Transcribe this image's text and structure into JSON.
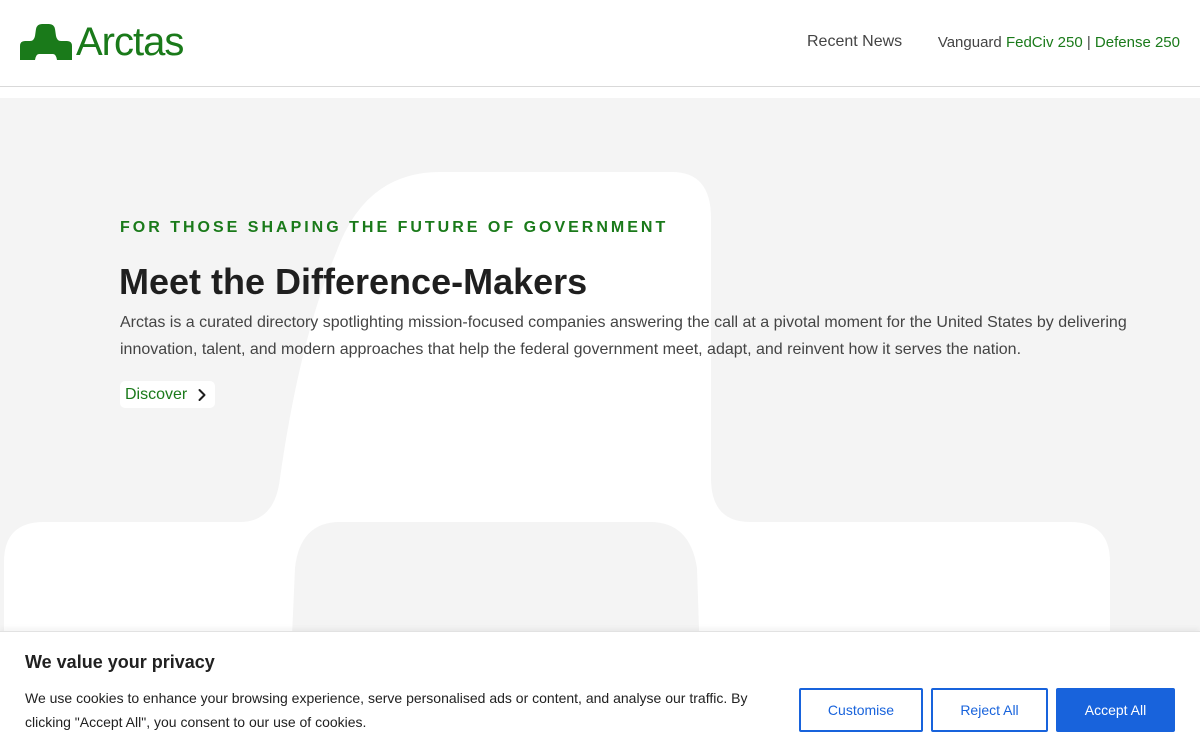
{
  "header": {
    "logo_text": "Arctas",
    "nav": {
      "recent_news": "Recent News",
      "vanguard_prefix": "Vanguard",
      "fedciv": "FedCiv 250",
      "separator": "|",
      "defense": "Defense 250"
    }
  },
  "hero": {
    "eyebrow": "FOR THOSE SHAPING THE FUTURE OF GOVERNMENT",
    "title": "Meet the Difference-Makers",
    "description": "Arctas is a curated directory spotlighting mission-focused companies answering the call at a pivotal moment for the United States by delivering innovation, talent, and modern approaches that help the federal government meet, adapt, and reinvent how it serves the nation.",
    "cta": {
      "label": "Discover",
      "icon": "chevron-right-icon"
    }
  },
  "cookie_banner": {
    "title": "We value your privacy",
    "text": "We use cookies to enhance your browsing experience, serve personalised ads or content, and analyse our traffic. By clicking \"Accept All\", you consent to our use of cookies.",
    "customise_label": "Customise",
    "reject_label": "Reject All",
    "accept_label": "Accept All"
  },
  "colors": {
    "brand_green": "#1a7a1a",
    "cookie_blue": "#1863dc",
    "hero_bg": "#f4f4f4"
  }
}
